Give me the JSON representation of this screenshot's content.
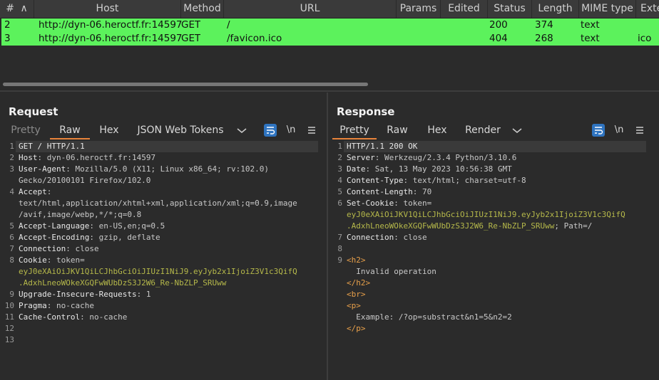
{
  "table": {
    "headers": [
      "#",
      "Host",
      "Method",
      "URL",
      "Params",
      "Edited",
      "Status",
      "Length",
      "MIME type",
      "Exte"
    ],
    "sort_glyph": "∧",
    "rows": [
      {
        "num": "2",
        "host": "http://dyn-06.heroctf.fr:14597",
        "method": "GET",
        "url": "/",
        "status": "200",
        "length": "374",
        "mime": "text",
        "ext": ""
      },
      {
        "num": "3",
        "host": "http://dyn-06.heroctf.fr:14597",
        "method": "GET",
        "url": "/favicon.ico",
        "status": "404",
        "length": "268",
        "mime": "text",
        "ext": "ico"
      }
    ]
  },
  "request": {
    "title": "Request",
    "tabs": [
      "Pretty",
      "Raw",
      "Hex",
      "JSON Web Tokens"
    ],
    "active_tab": "Raw",
    "newline_label": "\\n",
    "lines": [
      {
        "n": "1",
        "parts": [
          {
            "t": "GET / HTTP/1.1",
            "c": "key"
          }
        ]
      },
      {
        "n": "2",
        "parts": [
          {
            "t": "Host",
            "c": "key"
          },
          {
            "t": ": dyn-06.heroctf.fr:14597",
            "c": "val"
          }
        ]
      },
      {
        "n": "3",
        "parts": [
          {
            "t": "User-Agent",
            "c": "key"
          },
          {
            "t": ": Mozilla/5.0 (X11; Linux x86_64; rv:102.0)",
            "c": "val"
          }
        ]
      },
      {
        "n": "",
        "parts": [
          {
            "t": "Gecko/20100101 Firefox/102.0",
            "c": "val"
          }
        ]
      },
      {
        "n": "4",
        "parts": [
          {
            "t": "Accept",
            "c": "key"
          },
          {
            "t": ":",
            "c": "val"
          }
        ]
      },
      {
        "n": "",
        "parts": [
          {
            "t": "text/html,application/xhtml+xml,application/xml;q=0.9,image",
            "c": "val"
          }
        ]
      },
      {
        "n": "",
        "parts": [
          {
            "t": "/avif,image/webp,*/*;q=0.8",
            "c": "val"
          }
        ]
      },
      {
        "n": "5",
        "parts": [
          {
            "t": "Accept-Language",
            "c": "key"
          },
          {
            "t": ": en-US,en;q=0.5",
            "c": "val"
          }
        ]
      },
      {
        "n": "6",
        "parts": [
          {
            "t": "Accept-Encoding",
            "c": "key"
          },
          {
            "t": ": gzip, deflate",
            "c": "val"
          }
        ]
      },
      {
        "n": "7",
        "parts": [
          {
            "t": "Connection",
            "c": "key"
          },
          {
            "t": ": close",
            "c": "val"
          }
        ]
      },
      {
        "n": "8",
        "parts": [
          {
            "t": "Cookie",
            "c": "key"
          },
          {
            "t": ": token=",
            "c": "val"
          }
        ]
      },
      {
        "n": "",
        "parts": [
          {
            "t": "eyJ0eXAiOiJKV1QiLCJhbGciOiJIUzI1NiJ9.eyJyb2x1IjoiZ3V1c3QifQ",
            "c": "tok"
          }
        ]
      },
      {
        "n": "",
        "parts": [
          {
            "t": ".AdxhLneoWOkeXGQFwWUbDzS3J2W6_Re-NbZLP_SRUww",
            "c": "tok"
          }
        ]
      },
      {
        "n": "9",
        "parts": [
          {
            "t": "Upgrade-Insecure-Requests",
            "c": "key"
          },
          {
            "t": ": 1",
            "c": "val"
          }
        ]
      },
      {
        "n": "10",
        "parts": [
          {
            "t": "Pragma",
            "c": "key"
          },
          {
            "t": ": no-cache",
            "c": "val"
          }
        ]
      },
      {
        "n": "11",
        "parts": [
          {
            "t": "Cache-Control",
            "c": "key"
          },
          {
            "t": ": no-cache",
            "c": "val"
          }
        ]
      },
      {
        "n": "12",
        "parts": []
      },
      {
        "n": "13",
        "parts": []
      }
    ]
  },
  "response": {
    "title": "Response",
    "tabs": [
      "Pretty",
      "Raw",
      "Hex",
      "Render"
    ],
    "active_tab": "Pretty",
    "newline_label": "\\n",
    "lines": [
      {
        "n": "1",
        "parts": [
          {
            "t": "HTTP/1.1 200 OK",
            "c": "key"
          }
        ]
      },
      {
        "n": "2",
        "parts": [
          {
            "t": "Server",
            "c": "key"
          },
          {
            "t": ": Werkzeug/2.3.4 Python/3.10.6",
            "c": "val"
          }
        ]
      },
      {
        "n": "3",
        "parts": [
          {
            "t": "Date",
            "c": "key"
          },
          {
            "t": ": Sat, 13 May 2023 10:56:38 GMT",
            "c": "val"
          }
        ]
      },
      {
        "n": "4",
        "parts": [
          {
            "t": "Content-Type",
            "c": "key"
          },
          {
            "t": ": text/html; charset=utf-8",
            "c": "val"
          }
        ]
      },
      {
        "n": "5",
        "parts": [
          {
            "t": "Content-Length",
            "c": "key"
          },
          {
            "t": ": 70",
            "c": "val"
          }
        ]
      },
      {
        "n": "6",
        "parts": [
          {
            "t": "Set-Cookie",
            "c": "key"
          },
          {
            "t": ": token=",
            "c": "val"
          }
        ]
      },
      {
        "n": "",
        "parts": [
          {
            "t": "eyJ0eXAiOiJKV1QiLCJhbGciOiJIUzI1NiJ9.eyJyb2x1IjoiZ3V1c3QifQ",
            "c": "tok"
          }
        ]
      },
      {
        "n": "",
        "parts": [
          {
            "t": ".AdxhLneoWOkeXGQFwWUbDzS3J2W6_Re-NbZLP_SRUww",
            "c": "tok"
          },
          {
            "t": "; Path=/",
            "c": "val"
          }
        ]
      },
      {
        "n": "7",
        "parts": [
          {
            "t": "Connection",
            "c": "key"
          },
          {
            "t": ": close",
            "c": "val"
          }
        ]
      },
      {
        "n": "8",
        "parts": []
      },
      {
        "n": "9",
        "parts": [
          {
            "t": "<h2>",
            "c": "tag"
          }
        ]
      },
      {
        "n": "",
        "parts": [
          {
            "t": "  Invalid operation",
            "c": "val"
          }
        ]
      },
      {
        "n": "",
        "parts": [
          {
            "t": "</h2>",
            "c": "tag"
          }
        ]
      },
      {
        "n": "",
        "parts": [
          {
            "t": "<br>",
            "c": "tag"
          }
        ]
      },
      {
        "n": "",
        "parts": [
          {
            "t": "<p>",
            "c": "tag"
          }
        ]
      },
      {
        "n": "",
        "parts": [
          {
            "t": "  Example: /?op=substract&n1=5&n2=2",
            "c": "val"
          }
        ]
      },
      {
        "n": "",
        "parts": [
          {
            "t": "</p>",
            "c": "tag"
          }
        ]
      }
    ]
  },
  "icons": {
    "wrap": "wrap-lines-icon",
    "menu": "hamburger-menu-icon",
    "dropdown": "chevron-down-icon",
    "layout_side": "layout-side-by-side-icon",
    "layout_top": "layout-top-bottom-icon",
    "layout_tabs": "layout-tabs-icon"
  },
  "colors": {
    "row_highlight": "#5cf25c",
    "accent_tab": "#e8833a",
    "button_blue": "#2f74c0",
    "token_text": "#b5b84a"
  }
}
